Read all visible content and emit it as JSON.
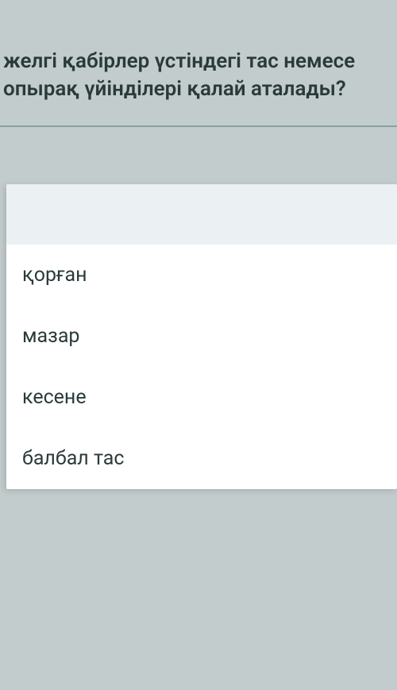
{
  "question": {
    "text": "желгі қабірлер үстіндегі тас немесе опырақ үйінділері қалай аталады?"
  },
  "options": {
    "items": [
      {
        "label": "қорған"
      },
      {
        "label": "мазар"
      },
      {
        "label": "кесене"
      },
      {
        "label": "балбал тас"
      }
    ]
  }
}
